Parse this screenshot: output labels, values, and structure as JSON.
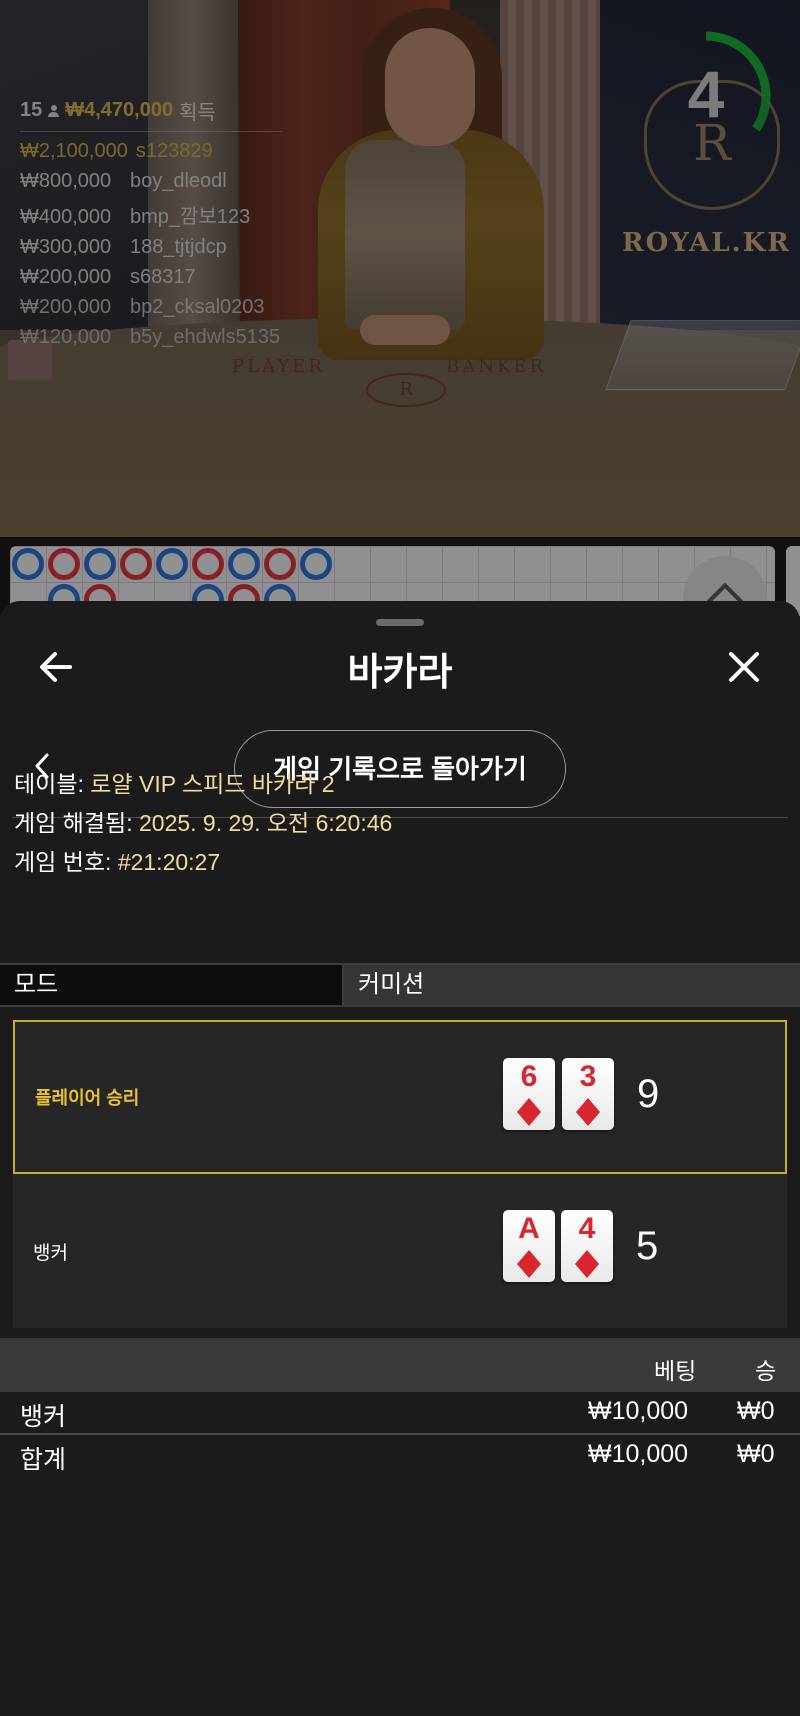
{
  "stream": {
    "round_timer": "4",
    "brand_logo_text": "ROYAL.KR",
    "brand_logo_letter": "R",
    "table_labels": {
      "player": "PLAYER",
      "banker": "BANKER"
    },
    "winners": {
      "count": "15",
      "total": "₩4,470,000",
      "total_suffix": "획득",
      "rows": [
        {
          "amount": "₩2,100,000",
          "user": "s123829"
        },
        {
          "amount": "₩800,000",
          "user": "boy_dleodl"
        },
        {
          "amount": "₩400,000",
          "user": "bmp_깜보123"
        },
        {
          "amount": "₩300,000",
          "user": "188_tjtjdcp"
        },
        {
          "amount": "₩200,000",
          "user": "s68317"
        },
        {
          "amount": "₩200,000",
          "user": "bp2_cksal0203"
        },
        {
          "amount": "₩120,000",
          "user": "b5y_ehdwls5135"
        }
      ]
    },
    "road_map": {
      "row1": [
        "B",
        "R",
        "B",
        "R",
        "B",
        "R",
        "B",
        "R",
        "B"
      ],
      "row2": [
        "",
        "B",
        "R",
        "",
        "",
        "B",
        "R",
        "B"
      ]
    }
  },
  "sheet": {
    "title": "바카라",
    "return_button": "게임 기록으로 돌아가기",
    "info": {
      "table_label": "테이블:",
      "table_value": "로얄 VIP 스피드 바카라 2",
      "resolved_label": "게임 해결됨:",
      "resolved_value": "2025. 9. 29. 오전 6:20:46",
      "game_no_label": "게임 번호:",
      "game_no_value": "#21:20:27"
    },
    "mode": {
      "label": "모드",
      "value": "커미션"
    },
    "results": [
      {
        "label": "플레이어 승리",
        "winner": true,
        "cards": [
          {
            "rank": "6",
            "suit": "diamond"
          },
          {
            "rank": "3",
            "suit": "diamond"
          }
        ],
        "score": "9"
      },
      {
        "label": "뱅커",
        "winner": false,
        "cards": [
          {
            "rank": "A",
            "suit": "diamond"
          },
          {
            "rank": "4",
            "suit": "diamond"
          }
        ],
        "score": "5"
      }
    ],
    "bets": {
      "headers": {
        "bet": "베팅",
        "win": "승"
      },
      "rows": [
        {
          "name": "뱅커",
          "bet": "₩10,000",
          "win": "₩0"
        },
        {
          "name": "합계",
          "bet": "₩10,000",
          "win": "₩0"
        }
      ]
    }
  },
  "colors": {
    "highlight_gold": "#c9ae36",
    "card_red": "#d8262f",
    "road_banker": "#d8333e",
    "road_player": "#2c6fcf",
    "timer_green": "#1faa3a"
  }
}
